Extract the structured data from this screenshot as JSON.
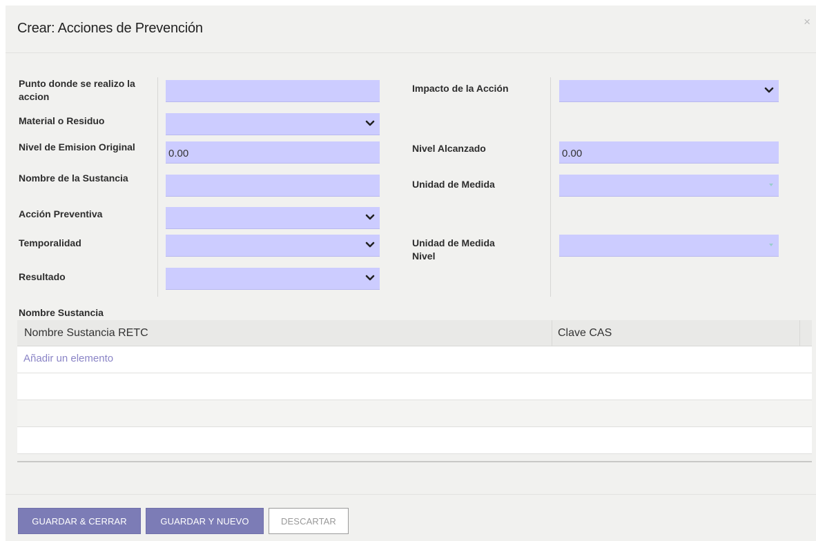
{
  "modal": {
    "title": "Crear: Acciones de Prevención",
    "close": "×"
  },
  "form": {
    "punto_label": "Punto donde se realizo la accion",
    "punto_value": "",
    "material_label": "Material o Residuo",
    "material_value": "",
    "nivel_emision_label": "Nivel de Emision Original",
    "nivel_emision_value": "0.00",
    "nombre_sustancia_label": "Nombre de la Sustancia",
    "nombre_sustancia_value": "",
    "accion_preventiva_label": "Acción Preventiva",
    "accion_preventiva_value": "",
    "temporalidad_label": "Temporalidad",
    "temporalidad_value": "",
    "resultado_label": "Resultado",
    "resultado_value": "",
    "impacto_label": "Impacto de la Acción",
    "impacto_value": "",
    "nivel_alcanzado_label": "Nivel Alcanzado",
    "nivel_alcanzado_value": "0.00",
    "unidad_medida_label": "Unidad de Medida",
    "unidad_medida_value": "",
    "unidad_medida_nivel_label": "Unidad de Medida Nivel",
    "unidad_medida_nivel_value": ""
  },
  "substances": {
    "section_title": "Nombre Sustancia",
    "columns": [
      "Nombre Sustancia RETC",
      "Clave CAS"
    ],
    "add_item": "Añadir un elemento",
    "rows": []
  },
  "footer": {
    "save_close": "GUARDAR & CERRAR",
    "save_new": "GUARDAR Y NUEVO",
    "discard": "DESCARTAR"
  },
  "colors": {
    "field_bg": "#ccccff",
    "primary_button": "#7c7cb6",
    "link": "#8a84c6",
    "modal_bg": "#f1f1ef"
  },
  "icons": {
    "dropdown": "chevron-down-icon",
    "small_dropdown": "caret-down-icon",
    "close": "close-icon"
  }
}
